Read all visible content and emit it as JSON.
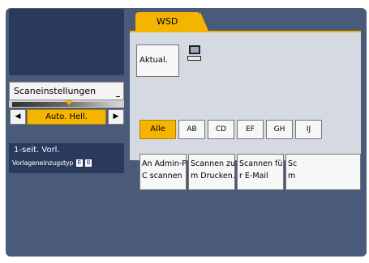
{
  "left": {
    "scan_settings_label": "Scaneinstellungen",
    "brightness": {
      "decrease_glyph": "◀",
      "auto_label": "Auto. Hell.",
      "increase_glyph": "▶"
    },
    "original": {
      "line1": "1-seit. Vorl.",
      "line2": "Vorlageneinzugstyp",
      "icon1": "B",
      "icon2": "B"
    }
  },
  "right": {
    "tab_label": "WSD",
    "refresh_label": "Aktual.",
    "filter_tabs": [
      "Alle",
      "AB",
      "CD",
      "EF",
      "GH",
      "IJ"
    ],
    "destinations": [
      {
        "line1": "An Admin-P",
        "line2": "C scannen"
      },
      {
        "line1": "Scannen zu",
        "line2": "m Drucken."
      },
      {
        "line1": "Scannen fü",
        "line2": "r E-Mail"
      },
      {
        "line1": "Sc",
        "line2": "m"
      }
    ]
  },
  "colors": {
    "accent": "#f4b400",
    "panel_dark": "#2a3a5c",
    "screen_bg": "#4a5b79",
    "content_bg": "#d5d9e1"
  },
  "icons": [
    "computer-icon",
    "triangle-left-icon",
    "triangle-right-icon",
    "brightness-marker-icon"
  ]
}
